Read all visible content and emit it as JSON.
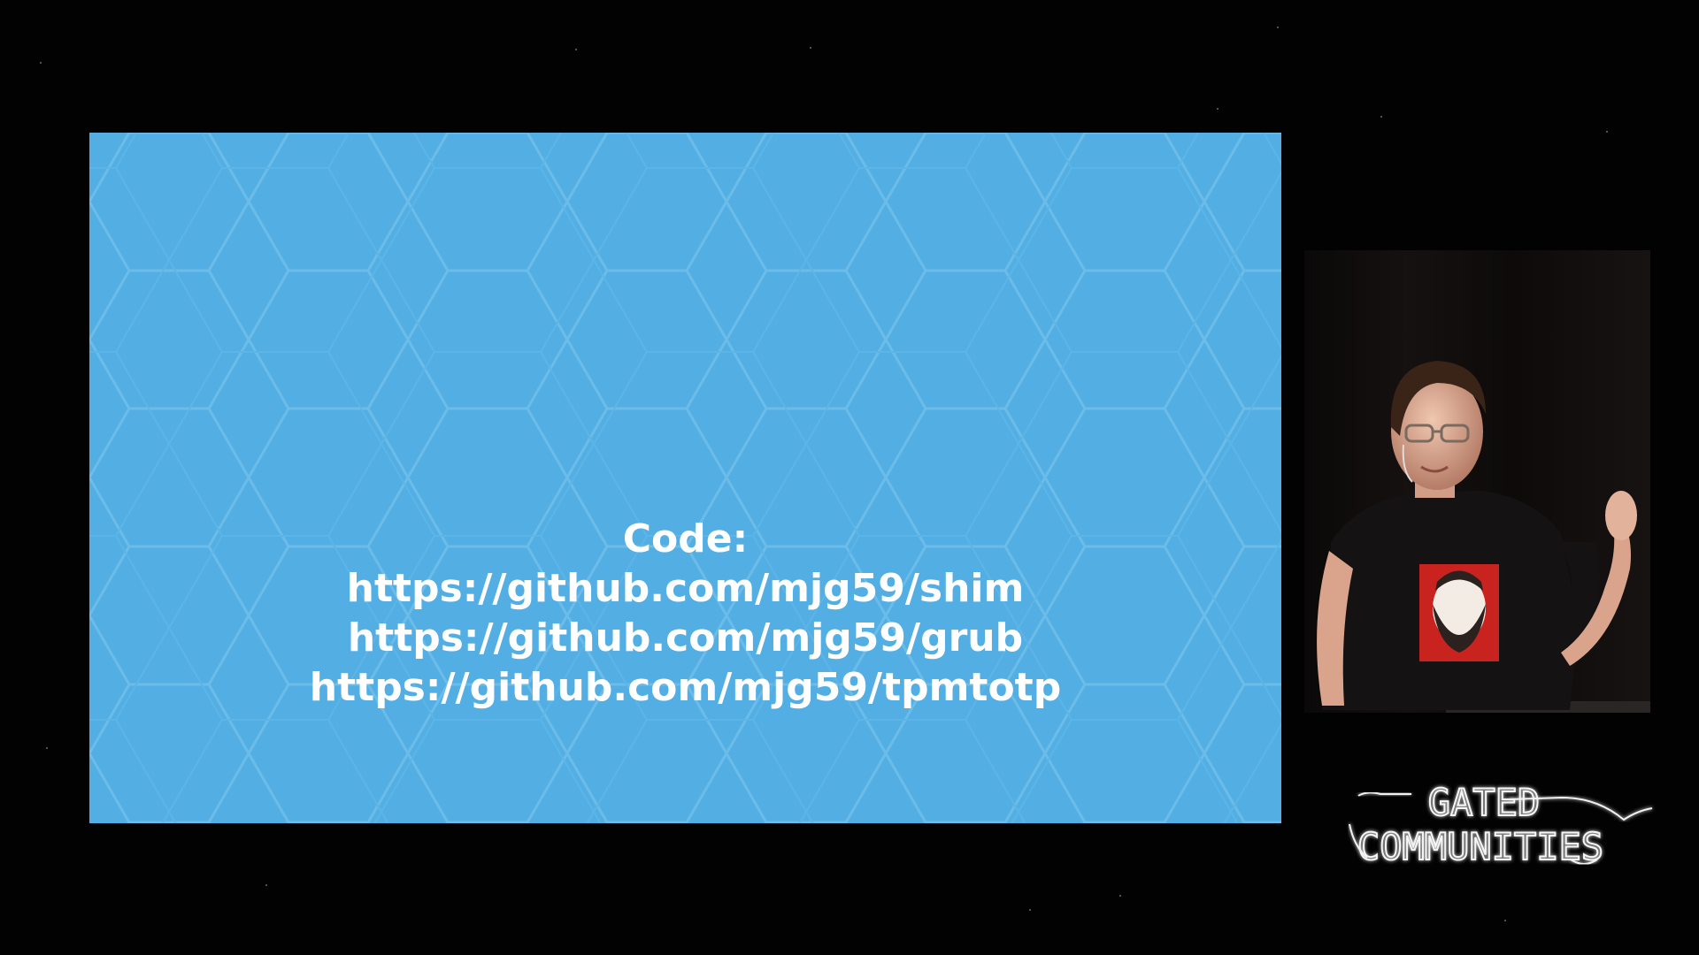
{
  "slide": {
    "heading": "Code:",
    "links": [
      "https://github.com/mjg59/shim",
      "https://github.com/mjg59/grub",
      "https://github.com/mjg59/tpmtotp"
    ],
    "background_color": "#52aee3",
    "text_color": "#ffffff"
  },
  "speaker": {
    "shirt_print_color": "#c8231e"
  },
  "event_logo": {
    "line1": "GATED",
    "line2": "COMMUNITIES"
  }
}
